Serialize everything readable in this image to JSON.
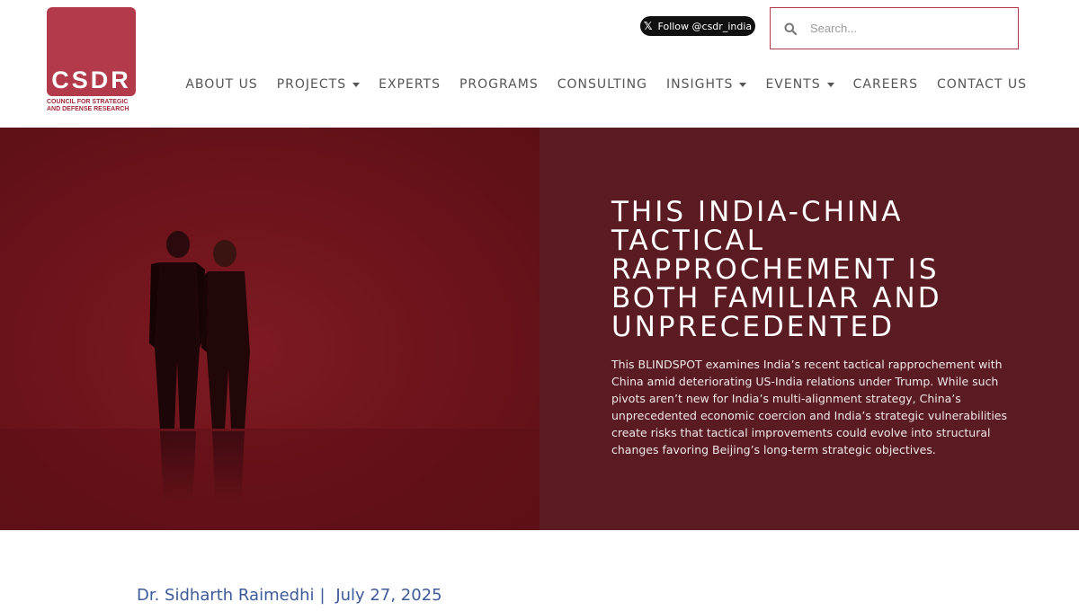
{
  "logo": {
    "text": "CSDR",
    "subtitle_line1": "COUNCIL FOR STRATEGIC",
    "subtitle_line2": "AND DEFENSE RESEARCH",
    "brand_color": "#b33a4a"
  },
  "social": {
    "follow_label": "Follow @csdr_india",
    "icon": "x-logo-icon"
  },
  "search": {
    "placeholder": "Search..."
  },
  "nav": {
    "items": [
      {
        "label": "ABOUT US",
        "dropdown": false
      },
      {
        "label": "PROJECTS",
        "dropdown": true
      },
      {
        "label": "EXPERTS",
        "dropdown": false
      },
      {
        "label": "PROGRAMS",
        "dropdown": false
      },
      {
        "label": "CONSULTING",
        "dropdown": false
      },
      {
        "label": "INSIGHTS",
        "dropdown": true
      },
      {
        "label": "EVENTS",
        "dropdown": true
      },
      {
        "label": "CAREERS",
        "dropdown": false
      },
      {
        "label": "CONTACT US",
        "dropdown": false
      }
    ]
  },
  "hero": {
    "title": "THIS INDIA-CHINA TACTICAL RAPPROCHEMENT IS BOTH FAMILIAR AND UNPRECEDENTED",
    "description": "This BLINDSPOT examines India’s recent tactical rapprochement with China amid deteriorating US-India relations under Trump. While such pivots aren’t new for India’s multi-alignment strategy, China’s unprecedented economic coercion and India’s strategic vulnerabilities create risks that tactical improvements could evolve into structural changes favoring Beijing’s long-term strategic objectives.",
    "panel_color": "#5a1c22",
    "image_color": "#6f141c"
  },
  "byline": {
    "author": "Dr. Sidharth Raimedhi",
    "separator": "|",
    "date": "July 27, 2025",
    "color": "#3d5a99"
  }
}
